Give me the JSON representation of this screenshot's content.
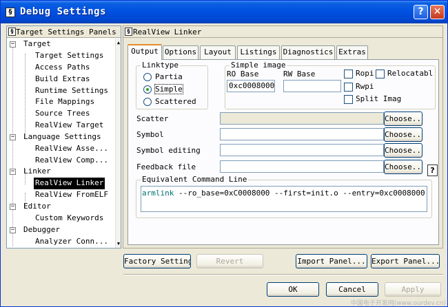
{
  "window": {
    "title": "Debug Settings",
    "help_glyph": "?",
    "close_glyph": "✕"
  },
  "tree": {
    "header": "Target Settings Panels",
    "items": [
      {
        "label": "Target"
      },
      {
        "label": "Target Settings"
      },
      {
        "label": "Access Paths"
      },
      {
        "label": "Build Extras"
      },
      {
        "label": "Runtime Settings"
      },
      {
        "label": "File Mappings"
      },
      {
        "label": "Source Trees"
      },
      {
        "label": "RealView Target"
      },
      {
        "label": "Language Settings"
      },
      {
        "label": "RealView Asse..."
      },
      {
        "label": "RealView Comp..."
      },
      {
        "label": "Linker"
      },
      {
        "label": "RealView Linker"
      },
      {
        "label": "RealView FromELF"
      },
      {
        "label": "Editor"
      },
      {
        "label": "Custom Keywords"
      },
      {
        "label": "Debugger"
      },
      {
        "label": "Analyzer Conn..."
      }
    ],
    "expander_glyph": "−"
  },
  "panel": {
    "title": "RealView Linker",
    "tabs": [
      "Output",
      "Options",
      "Layout",
      "Listings",
      "Diagnostics",
      "Extras"
    ],
    "active_tab": "Output",
    "linktype": {
      "legend": "Linktype",
      "options": [
        "Partia",
        "Simple",
        "Scattered"
      ],
      "selected": "Simple"
    },
    "simple_image": {
      "legend": "Simple image",
      "ro_base_label": "RO Base",
      "ro_base_value": "0xc0008000",
      "rw_base_label": "RW Base",
      "rw_base_value": "",
      "checkboxes": [
        "Ropi",
        "Relocatabl",
        "Rwpi",
        "Split Imag"
      ]
    },
    "file_rows": [
      {
        "label": "Scatter",
        "value": "",
        "button": "Choose..."
      },
      {
        "label": "Symbol",
        "value": "",
        "button": "Choose..."
      },
      {
        "label": "Symbol editing",
        "value": "",
        "button": "Choose..."
      },
      {
        "label": "Feedback file",
        "value": "",
        "button": "Choose..."
      }
    ],
    "help_glyph": "?",
    "command": {
      "legend": "Equivalent Command Line",
      "keyword": "armlink",
      "args": " --ro_base=0xC0008000 --first=init.o --entry=0xc0008000"
    }
  },
  "buttons": {
    "factory": "Factory Settings",
    "revert": "Revert",
    "import": "Import Panel...",
    "export": "Export Panel...",
    "ok": "OK",
    "cancel": "Cancel",
    "apply": "Apply"
  },
  "watermark": "中国电子开发网(www.ourdev.cn)"
}
